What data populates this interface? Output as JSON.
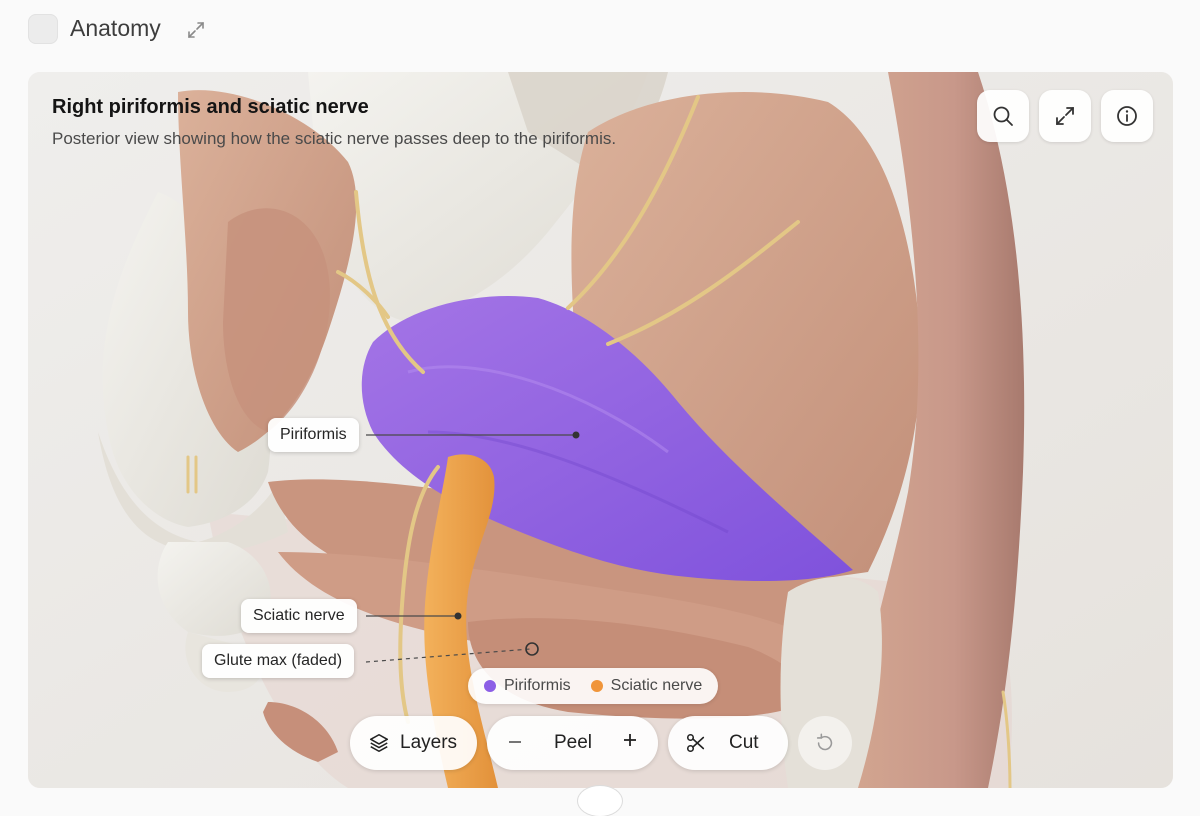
{
  "app": {
    "title": "Anatomy"
  },
  "viewer": {
    "title": "Right piriformis and sciatic nerve",
    "subtitle": "Posterior view showing how the sciatic nerve passes deep to the piriformis."
  },
  "icons": {
    "header": [
      "app-icon",
      "expand-icon"
    ],
    "toolbar": [
      "search-icon",
      "fullscreen-icon",
      "info-icon"
    ],
    "bottom": [
      "layers-icon",
      "minus-icon",
      "plus-icon",
      "scissors-icon",
      "reset-icon"
    ]
  },
  "labels": {
    "piriformis": "Piriformis",
    "sciatic": "Sciatic nerve",
    "glute": "Glute max (faded)"
  },
  "legend": [
    {
      "label": "Piriformis",
      "color": "#8c5fe6"
    },
    {
      "label": "Sciatic nerve",
      "color": "#f0953a"
    }
  ],
  "controls": {
    "layers": "Layers",
    "peel": "Peel",
    "cut": "Cut"
  },
  "colors": {
    "piriformis": "#9163e0",
    "sciatic": "#eea04a",
    "muscle": "#c99a86",
    "bone": "#e9e6e0",
    "nerve": "#e5c98a"
  }
}
